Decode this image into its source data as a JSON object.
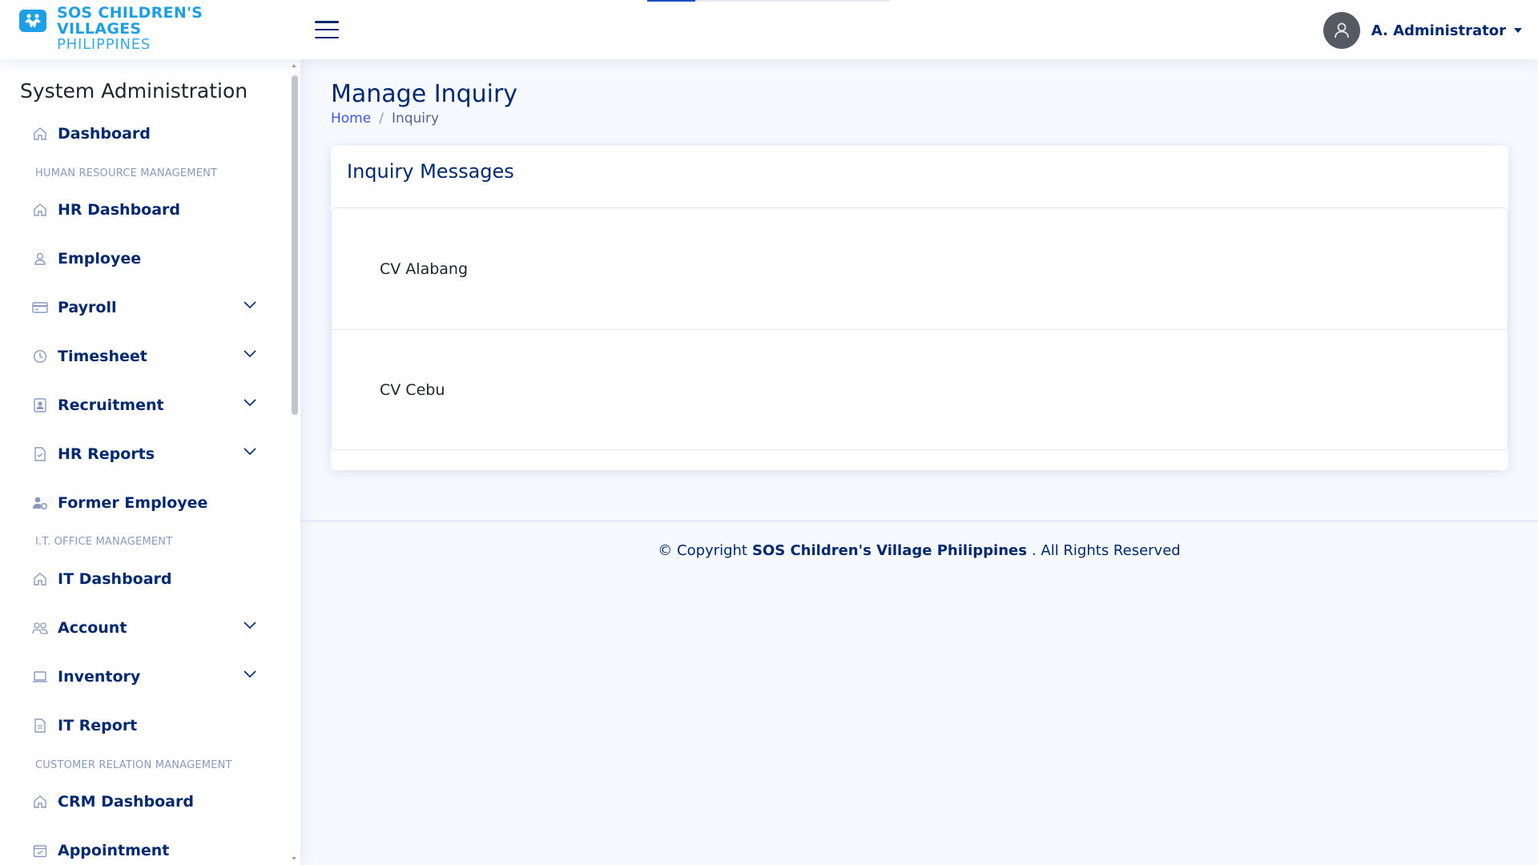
{
  "header": {
    "logo_line1": "SOS CHILDREN'S",
    "logo_line2": "VILLAGES",
    "logo_line3": "PHILIPPINES",
    "user_name": "A. Administrator"
  },
  "sidebar": {
    "title": "System Administration",
    "dashboard": "Dashboard",
    "sections": {
      "hr": "HUMAN RESOURCE MANAGEMENT",
      "it": "I.T. OFFICE MANAGEMENT",
      "crm": "CUSTOMER RELATION MANAGEMENT"
    },
    "items": {
      "hr_dashboard": "HR Dashboard",
      "employee": "Employee",
      "payroll": "Payroll",
      "timesheet": "Timesheet",
      "recruitment": "Recruitment",
      "hr_reports": "HR Reports",
      "former_employee": "Former Employee",
      "it_dashboard": "IT Dashboard",
      "account": "Account",
      "inventory": "Inventory",
      "it_report": "IT Report",
      "crm_dashboard": "CRM Dashboard",
      "appointment": "Appointment"
    }
  },
  "main": {
    "page_title": "Manage Inquiry",
    "breadcrumb": {
      "home": "Home",
      "current": "Inquiry"
    },
    "card_title": "Inquiry Messages",
    "inquiries": [
      "CV Alabang",
      "CV Cebu"
    ]
  },
  "footer": {
    "prefix": "© Copyright",
    "org": "SOS Children's Village Philippines",
    "suffix": ". All Rights Reserved"
  },
  "colors": {
    "brand_blue": "#1e9ee4",
    "nav_text": "#012970",
    "link": "#4154f1",
    "background": "#f6f9ff"
  }
}
